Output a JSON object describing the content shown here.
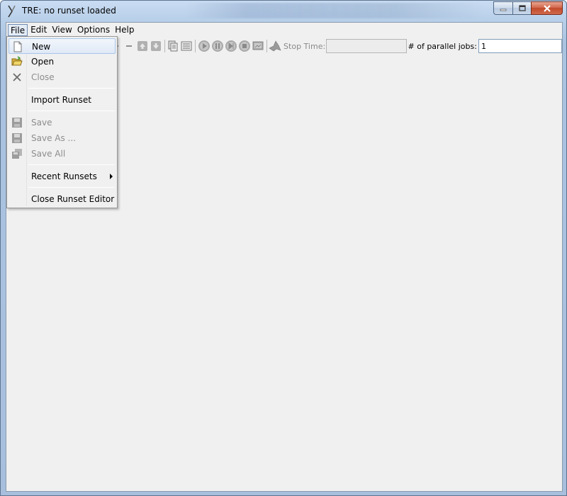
{
  "window": {
    "title": "TRE:  no runset loaded"
  },
  "menubar": {
    "items": [
      {
        "label": "File"
      },
      {
        "label": "Edit"
      },
      {
        "label": "View"
      },
      {
        "label": "Options"
      },
      {
        "label": "Help"
      }
    ]
  },
  "toolbar": {
    "stop_time_label": "Stop Time:",
    "stop_time_value": "",
    "parallel_jobs_label": "# of parallel jobs:",
    "parallel_jobs_value": "1",
    "icons": [
      "add-icon",
      "remove-icon",
      "move-up-icon",
      "move-down-icon",
      "copy-icon",
      "list-icon",
      "play-icon",
      "pause-icon",
      "step-icon",
      "stop-icon",
      "screen-icon",
      "matlab-icon"
    ]
  },
  "file_menu": {
    "items": [
      {
        "label": "New",
        "icon": "new-file-icon",
        "enabled": true
      },
      {
        "label": "Open",
        "icon": "open-folder-icon",
        "enabled": true
      },
      {
        "label": "Close",
        "icon": "close-x-icon",
        "enabled": false
      },
      {
        "label": "Import Runset",
        "icon": "",
        "enabled": true
      },
      {
        "label": "Save",
        "icon": "save-disk-icon",
        "enabled": false
      },
      {
        "label": "Save As ...",
        "icon": "save-as-disk-icon",
        "enabled": false
      },
      {
        "label": "Save All",
        "icon": "save-all-disk-icon",
        "enabled": false
      },
      {
        "label": "Recent Runsets",
        "icon": "",
        "enabled": true
      },
      {
        "label": "Close Runset Editor",
        "icon": "",
        "enabled": true
      }
    ]
  },
  "colors": {
    "accent_hover": "#dfe9f6",
    "disabled_text": "#8d8d8d",
    "close_button": "#c14a2b"
  }
}
